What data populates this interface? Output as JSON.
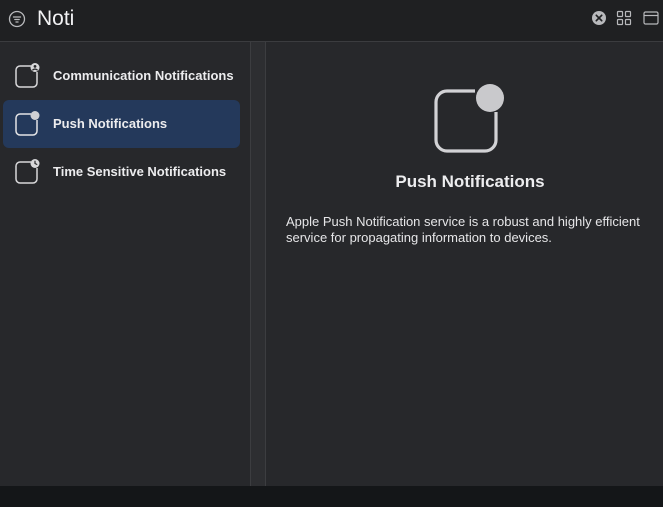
{
  "titlebar": {
    "search_text": "Noti",
    "icons": [
      "filter-icon",
      "clear-search-icon",
      "grid-view-icon",
      "sidebar-toggle-icon"
    ]
  },
  "sidebar": {
    "items": [
      {
        "label": "Communication Notifications",
        "icon": "communication-notification-icon",
        "selected": false
      },
      {
        "label": "Push Notifications",
        "icon": "push-notification-icon",
        "selected": true
      },
      {
        "label": "Time Sensitive Notifications",
        "icon": "time-sensitive-notification-icon",
        "selected": false
      }
    ]
  },
  "detail": {
    "title": "Push Notifications",
    "description": "Apple Push Notification service is a robust and highly efficient service for propagating information to devices."
  },
  "colors": {
    "background": "#27282b",
    "titlebar": "#1f2022",
    "selection": "#24395b",
    "text": "#e8e8ea"
  }
}
